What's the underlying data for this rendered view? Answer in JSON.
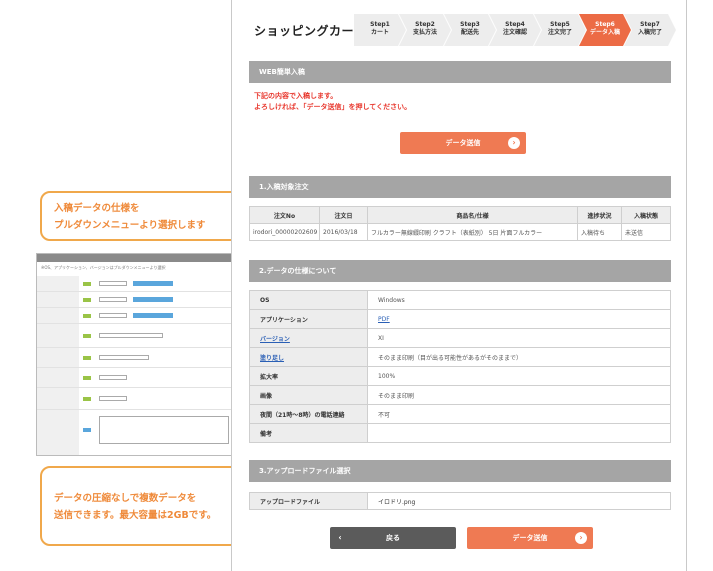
{
  "header": {
    "title": "ショッピングカート",
    "steps": [
      {
        "num": "Step1",
        "label": "カート"
      },
      {
        "num": "Step2",
        "label": "支払方法"
      },
      {
        "num": "Step3",
        "label": "配送先"
      },
      {
        "num": "Step4",
        "label": "注文確認"
      },
      {
        "num": "Step5",
        "label": "注文完了"
      },
      {
        "num": "Step6",
        "label": "データ入稿"
      },
      {
        "num": "Step7",
        "label": "入稿完了"
      }
    ],
    "active_step": 6
  },
  "web_section": {
    "title": "WEB簡単入稿",
    "notice_line1": "下記の内容で入稿します。",
    "notice_line2": "よろしければ、「データ送信」を押してください。",
    "submit_label": "データ送信"
  },
  "order_section": {
    "title": "1.入稿対象注文",
    "columns": [
      "注文No",
      "注文日",
      "商品名/仕様",
      "進捗状況",
      "入稿状態"
    ],
    "rows": [
      [
        "irodori_00000202609",
        "2016/03/18",
        "フルカラー無線綴印刷 クラフト（表紙別） 5日 片面フルカラー",
        "入稿待ち",
        "未送信"
      ]
    ]
  },
  "spec_section": {
    "title": "2.データの仕様について",
    "rows": [
      {
        "key": "OS",
        "value": "Windows",
        "key_link": false,
        "value_link": false
      },
      {
        "key": "アプリケーション",
        "value": "PDF",
        "key_link": false,
        "value_link": true
      },
      {
        "key": "バージョン",
        "value": "XI",
        "key_link": true,
        "value_link": false
      },
      {
        "key": "塗り足し",
        "value": "そのまま印刷（目が出る可能性があるがそのままで）",
        "key_link": true,
        "value_link": false
      },
      {
        "key": "拡大率",
        "value": "100%",
        "key_link": false,
        "value_link": false
      },
      {
        "key": "画像",
        "value": "そのまま印刷",
        "key_link": false,
        "value_link": false
      },
      {
        "key": "夜間（21時～8時）の電話連絡",
        "value": "不可",
        "key_link": false,
        "value_link": false
      },
      {
        "key": "備考",
        "value": "",
        "key_link": false,
        "value_link": false
      }
    ]
  },
  "upload_section": {
    "title": "3.アップロードファイル選択",
    "key": "アップロードファイル",
    "value": "イロドリ.png"
  },
  "footer": {
    "back_label": "戻る",
    "submit_label": "データ送信"
  },
  "callouts": {
    "top_line1": "入稿データの仕様を",
    "top_line2": "プルダウンメニューより選択します",
    "bottom_line1": "データの圧縮なしで複数データを",
    "bottom_line2": "送信できます。最大容量は2GBです。"
  },
  "thumbnail": {
    "header": "2.データの仕様について",
    "hint": "※OS、アプリケーション、バージョンはプルダウンメニューより選択",
    "os": "Windows",
    "app": "PDF",
    "ver": "XI"
  },
  "colors": {
    "accent": "#ec6b45",
    "callout_border": "#f0a84b",
    "arrow": "#4cb648",
    "section_bar": "#a5a5a5"
  }
}
